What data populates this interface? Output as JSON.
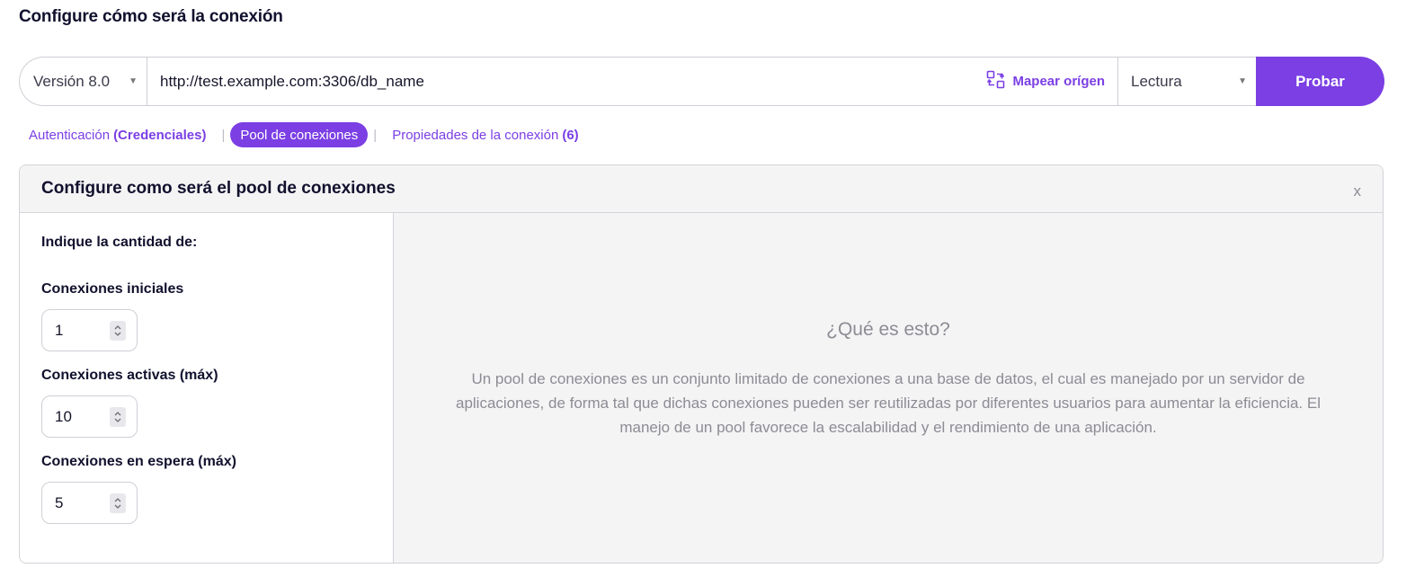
{
  "page": {
    "title": "Configure cómo será la conexión"
  },
  "connection_bar": {
    "version": "Versión 8.0",
    "url": "http://test.example.com:3306/db_name",
    "map_origin_label": "Mapear orígen",
    "mode": "Lectura",
    "test_label": "Probar"
  },
  "tabs": [
    {
      "label": "Autenticación",
      "suffix": "(Credenciales)",
      "active": false
    },
    {
      "label": "Pool de conexiones",
      "suffix": "",
      "active": true
    },
    {
      "label": "Propiedades de la conexión",
      "suffix": "(6)",
      "active": false
    }
  ],
  "tab_separator": "|",
  "panel": {
    "title": "Configure como será el pool de conexiones",
    "close_label": "x",
    "intro": "Indique la cantidad de:",
    "fields": [
      {
        "label": "Conexiones iniciales",
        "value": "1"
      },
      {
        "label": "Conexiones activas (máx)",
        "value": "10"
      },
      {
        "label": "Conexiones en espera (máx)",
        "value": "5"
      }
    ],
    "info": {
      "title": "¿Qué es esto?",
      "text": "Un pool de conexiones es un conjunto limitado de conexiones a una base de datos, el cual es manejado por un servidor de aplicaciones, de forma tal que dichas conexiones pueden ser reutilizadas por diferentes usuarios para aumentar la eficiencia. El manejo de un pool favorece la escalabilidad y el rendimiento de una aplicación."
    }
  },
  "colors": {
    "accent": "#7b3fe4",
    "panel_bg": "#f4f4f5",
    "muted_text": "#8c8c94"
  },
  "icons": {
    "map_origin": "map-origin-icon",
    "dropdown": "caret-down-icon",
    "stepper": "stepper-arrows-icon"
  }
}
